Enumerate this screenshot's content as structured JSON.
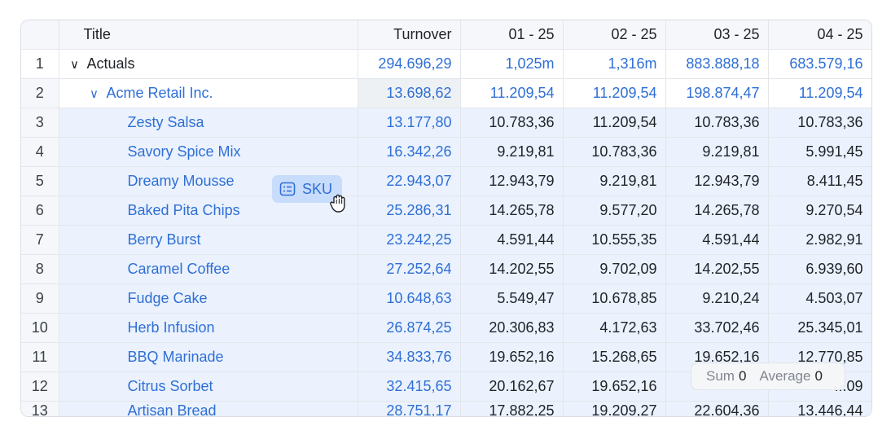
{
  "columns": [
    "Title",
    "Turnover",
    "01 - 25",
    "02 - 25",
    "03 - 25",
    "04 - 25"
  ],
  "rows": [
    {
      "num": "1",
      "title": "Actuals",
      "turnover": "294.696,29",
      "m1": "1,025m",
      "m2": "1,316m",
      "m3": "883.888,18",
      "m4": "683.579,16"
    },
    {
      "num": "2",
      "title": "Acme Retail Inc.",
      "turnover": "13.698,62",
      "m1": "11.209,54",
      "m2": "11.209,54",
      "m3": "198.874,47",
      "m4": "11.209,54"
    },
    {
      "num": "3",
      "title": "Zesty Salsa",
      "turnover": "13.177,80",
      "m1": "10.783,36",
      "m2": "11.209,54",
      "m3": "10.783,36",
      "m4": "10.783,36"
    },
    {
      "num": "4",
      "title": "Savory Spice Mix",
      "turnover": "16.342,26",
      "m1": "9.219,81",
      "m2": "10.783,36",
      "m3": "9.219,81",
      "m4": "5.991,45"
    },
    {
      "num": "5",
      "title": "Dreamy Mousse",
      "turnover": "22.943,07",
      "m1": "12.943,79",
      "m2": "9.219,81",
      "m3": "12.943,79",
      "m4": "8.411,45"
    },
    {
      "num": "6",
      "title": "Baked Pita Chips",
      "turnover": "25.286,31",
      "m1": "14.265,78",
      "m2": "9.577,20",
      "m3": "14.265,78",
      "m4": "9.270,54"
    },
    {
      "num": "7",
      "title": "Berry Burst",
      "turnover": "23.242,25",
      "m1": "4.591,44",
      "m2": "10.555,35",
      "m3": "4.591,44",
      "m4": "2.982,91"
    },
    {
      "num": "8",
      "title": "Caramel Coffee",
      "turnover": "27.252,64",
      "m1": "14.202,55",
      "m2": "9.702,09",
      "m3": "14.202,55",
      "m4": "6.939,60"
    },
    {
      "num": "9",
      "title": "Fudge Cake",
      "turnover": "10.648,63",
      "m1": "5.549,47",
      "m2": "10.678,85",
      "m3": "9.210,24",
      "m4": "4.503,07"
    },
    {
      "num": "10",
      "title": "Herb Infusion",
      "turnover": "26.874,25",
      "m1": "20.306,83",
      "m2": "4.172,63",
      "m3": "33.702,46",
      "m4": "25.345,01"
    },
    {
      "num": "11",
      "title": "BBQ Marinade",
      "turnover": "34.833,76",
      "m1": "19.652,16",
      "m2": "15.268,65",
      "m3": "19.652,16",
      "m4": "12.770,85"
    },
    {
      "num": "12",
      "title": "Citrus Sorbet",
      "turnover": "32.415,65",
      "m1": "20.162,67",
      "m2": "19.652,16",
      "m3": "",
      "m4": "...09"
    },
    {
      "num": "13",
      "title": "Artisan Bread",
      "turnover": "28.751,17",
      "m1": "17.882,25",
      "m2": "19.209,27",
      "m3": "22.604,36",
      "m4": "13.446,44"
    }
  ],
  "drag_chip": {
    "label": "SKU",
    "icon": "list-icon"
  },
  "cursor": {
    "icon": "grab-hand-icon"
  },
  "summary": {
    "sum_label": "Sum",
    "sum_value": "0",
    "avg_label": "Average",
    "avg_value": "0"
  },
  "colors": {
    "link": "#2f6fd6",
    "selection": "#ebf2fd",
    "chip": "#c8dcfb",
    "border": "#e3e7ec"
  }
}
